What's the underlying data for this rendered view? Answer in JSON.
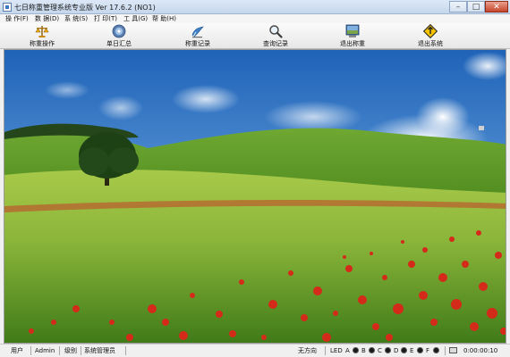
{
  "window": {
    "title": "七日称重管理系统专业版 Ver 17.6.2 (NO1)"
  },
  "menu": [
    {
      "label": "操 作(F)"
    },
    {
      "label": "数 据(D)"
    },
    {
      "label": "系 统(S)"
    },
    {
      "label": "打 印(T)"
    },
    {
      "label": "工 具(G)"
    },
    {
      "label": "帮 助(H)"
    }
  ],
  "toolbar": [
    {
      "label": "称重操作",
      "icon": "scale-icon"
    },
    {
      "label": "单日汇总",
      "icon": "summary-disc-icon"
    },
    {
      "label": "称重记录",
      "icon": "weighing-record-icon"
    },
    {
      "label": "查询记录",
      "icon": "magnifier-icon"
    },
    {
      "label": "退出称重",
      "icon": "exit-weighing-screen-icon"
    },
    {
      "label": "退出系统",
      "icon": "exit-system-sign-icon"
    }
  ],
  "status": {
    "user_label": "用户",
    "user_value": "Admin",
    "level_label": "级别",
    "level_value": "系统管理员",
    "direction": "无方向",
    "led_label": "LED",
    "led_letters": [
      "A",
      "B",
      "C",
      "D",
      "E",
      "F"
    ],
    "time": "0:00:00:10"
  },
  "colors": {
    "titlebar": "#c6d7ec",
    "toolbar": "#e7e7e7",
    "led_off": "#1a1a1a"
  }
}
